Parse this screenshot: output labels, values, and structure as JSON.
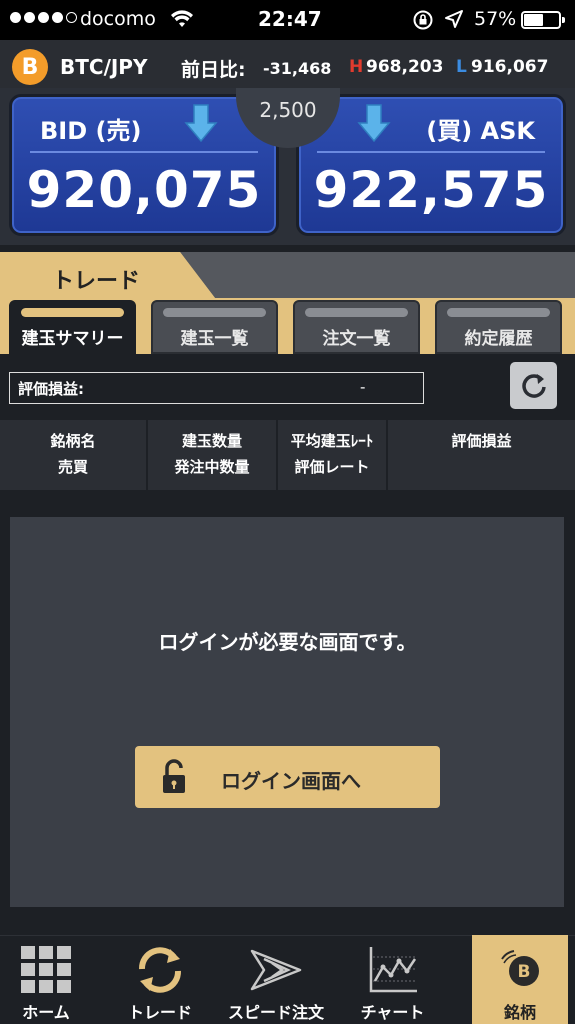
{
  "status_bar": {
    "carrier": "docomo",
    "time": "22:47",
    "battery_pct": "57%",
    "battery_level": 0.57
  },
  "ticker": {
    "coin_symbol": "B",
    "pair": "BTC/JPY",
    "change_label": "前日比:",
    "change_value": "-31,468",
    "high_tag": "H",
    "high_value": "968,203",
    "low_tag": "L",
    "low_value": "916,067",
    "high_color": "#e23b2e",
    "low_color": "#3b8ce2"
  },
  "bid": {
    "label": "BID (売)",
    "value": "920,075"
  },
  "ask": {
    "label": "(買) ASK",
    "value": "922,575"
  },
  "spread": "2,500",
  "trade": {
    "title": "トレード",
    "tabs": [
      {
        "label": "建玉サマリー",
        "active": true
      },
      {
        "label": "建玉一覧",
        "active": false
      },
      {
        "label": "注文一覧",
        "active": false
      },
      {
        "label": "約定履歴",
        "active": false
      }
    ]
  },
  "summary": {
    "pl_label": "評価損益:",
    "pl_value": "-",
    "columns": [
      {
        "line1": "銘柄名",
        "line2": "売買"
      },
      {
        "line1": "建玉数量",
        "line2": "発注中数量"
      },
      {
        "line1": "平均建玉ﾚｰﾄ",
        "line2": "評価レート"
      },
      {
        "line1": "評価損益",
        "line2": ""
      }
    ]
  },
  "login": {
    "message": "ログインが必要な画面です。",
    "button_label": "ログイン画面へ"
  },
  "nav": {
    "items": [
      {
        "label": "ホーム",
        "icon": "grid-icon"
      },
      {
        "label": "トレード",
        "icon": "trade-cycle-icon"
      },
      {
        "label": "スピード注文",
        "icon": "speed-arrows-icon"
      },
      {
        "label": "チャート",
        "icon": "chart-icon"
      },
      {
        "label": "銘柄",
        "icon": "bitcoin-icon",
        "coin_symbol": "B",
        "active": true
      }
    ]
  },
  "colors": {
    "accent_gold": "#e3c27f",
    "price_blue": "#2f4fb3",
    "arrow_blue": "#5bb3ea",
    "background": "#1d2025"
  }
}
